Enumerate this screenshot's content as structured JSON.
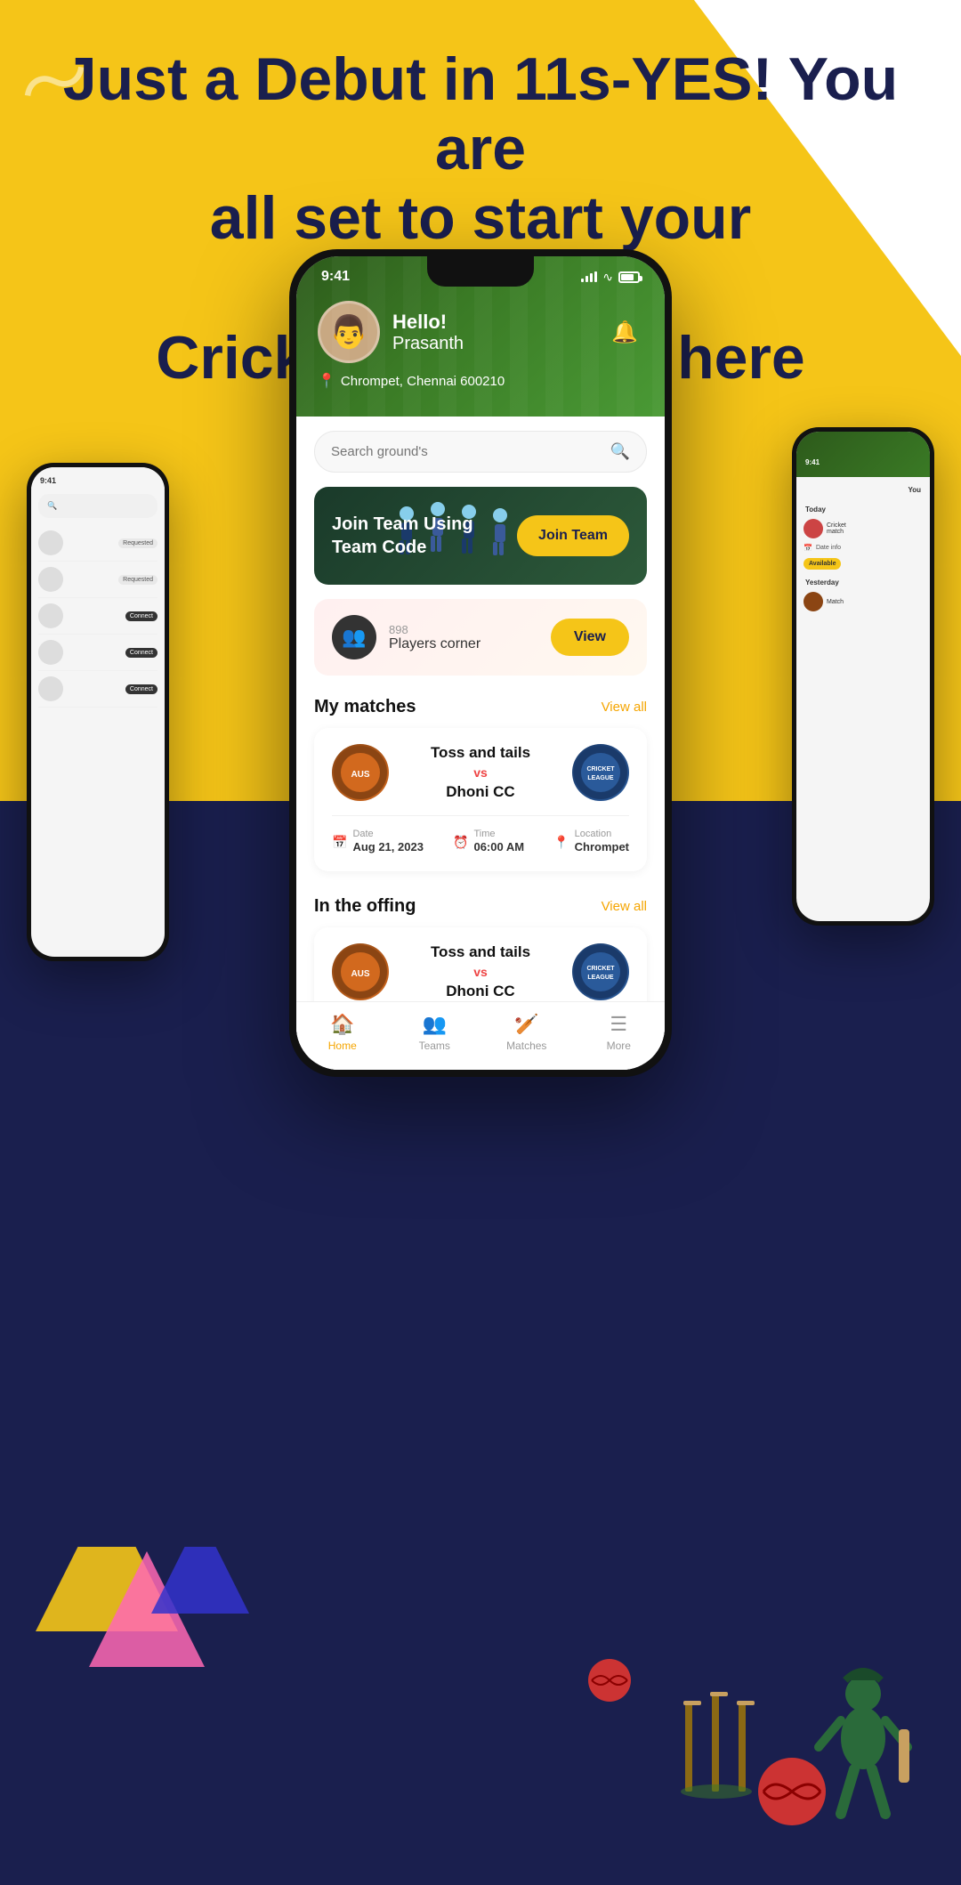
{
  "hero": {
    "line1": "Just a Debut in 11s-YES! You are",
    "line2": "all set to start your Professional",
    "line3": "Cricketing Career here"
  },
  "phone": {
    "status_bar": {
      "time": "9:41",
      "signal": "signal-icon",
      "wifi": "wifi-icon",
      "battery": "battery-icon"
    },
    "header": {
      "greeting": "Hello!",
      "name": "Prasanth",
      "location": "Chrompet, Chennai 600210",
      "avatar_emoji": "👨"
    },
    "search": {
      "placeholder": "Search ground's"
    },
    "join_banner": {
      "text": "Join Team Using\nTeam Code",
      "button_label": "Join Team"
    },
    "players_corner": {
      "count": "898 Players corner",
      "button_label": "View"
    },
    "my_matches": {
      "title": "My matches",
      "view_all": "View all",
      "matches": [
        {
          "team1": "Toss and tails",
          "team2": "Dhoni CC",
          "vs": "vs",
          "date_label": "Date",
          "date_value": "Aug 21, 2023",
          "time_label": "Time",
          "time_value": "06:00 AM",
          "location_label": "Location",
          "location_value": "Chrompet"
        }
      ]
    },
    "in_the_offing": {
      "title": "In the offing",
      "view_all": "View all",
      "matches": [
        {
          "team1": "Toss and tails",
          "team2": "Dhoni CC",
          "vs": "vs"
        }
      ]
    },
    "bottom_nav": {
      "items": [
        {
          "label": "Home",
          "icon": "🏠",
          "active": true
        },
        {
          "label": "Teams",
          "icon": "👥",
          "active": false
        },
        {
          "label": "Matches",
          "icon": "🏏",
          "active": false
        },
        {
          "label": "More",
          "icon": "☰",
          "active": false
        }
      ]
    }
  },
  "side_phone_left": {
    "time": "9:41",
    "list_items": [
      {
        "label": "Requested"
      },
      {
        "label": "Requested"
      },
      {
        "label": "Connect"
      },
      {
        "label": "Connect"
      },
      {
        "label": "Connect"
      }
    ]
  },
  "side_phone_right": {
    "time": "9:41",
    "you_label": "You",
    "today_label": "Today",
    "available_label": "Available",
    "yesterday_label": "Yesterday"
  },
  "colors": {
    "primary_yellow": "#F5C518",
    "navy": "#1a1f4e",
    "green": "#2d5a1b",
    "red_vs": "#e44444"
  }
}
